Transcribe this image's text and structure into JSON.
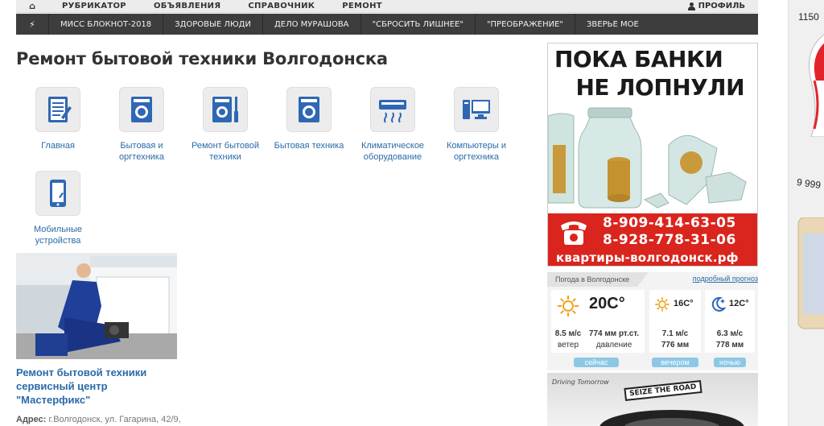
{
  "nav_top": {
    "home_icon": "home-icon",
    "items": [
      "РУБРИКАТОР",
      "ОБЪЯВЛЕНИЯ",
      "СПРАВОЧНИК",
      "РЕМОНТ"
    ],
    "profile": "ПРОФИЛЬ"
  },
  "nav_sub": {
    "bolt_icon": "bolt-icon",
    "items": [
      "МИСС БЛОКНОТ-2018",
      "ЗДОРОВЫЕ ЛЮДИ",
      "ДЕЛО МУРАШОВА",
      "\"СБРОСИТЬ ЛИШНЕЕ\"",
      "\"ПРЕОБРАЖЕНИЕ\"",
      "ЗВЕРЬЕ МОЕ"
    ]
  },
  "page_title": "Ремонт бытовой техники Волгодонска",
  "categories": [
    {
      "label": "Главная",
      "icon": "checklist-icon"
    },
    {
      "label": "Бытовая и оргтехника",
      "icon": "washing-machine-icon"
    },
    {
      "label": "Ремонт бытовой техники",
      "icon": "washing-machine-screwdriver-icon"
    },
    {
      "label": "Бытовая техника",
      "icon": "washing-machine-icon"
    },
    {
      "label": "Климатическое оборудование",
      "icon": "air-conditioner-icon"
    },
    {
      "label": "Компьютеры и оргтехника",
      "icon": "computer-icon"
    },
    {
      "label": "Мобильные устройства",
      "icon": "smartphone-icon"
    }
  ],
  "article": {
    "title": "Ремонт бытовой техники сервисный центр \"Мастерфикс\"",
    "address_label": "Адрес:",
    "address": "г.Волгодонск, ул. Гагарина, 42/9,"
  },
  "ad_banner": {
    "line1": "ПОКА БАНКИ",
    "line2": "НЕ ЛОПНУЛИ",
    "phone1": "8-909-414-63-05",
    "phone2": "8-928-778-31-06",
    "site": "квартиры-волгодонск.рф"
  },
  "weather": {
    "title": "Погода в Волгодонске",
    "more_link": "подробный прогноз",
    "now": {
      "temp": "20C°",
      "wind": "8.5 м/с",
      "wind_label": "ветер",
      "pressure": "774 мм рт.ст.",
      "pressure_label": "давление",
      "chip": "сейчас"
    },
    "evening": {
      "temp": "16C°",
      "wind": "7.1 м/с",
      "pressure": "776 мм",
      "chip": "вечером"
    },
    "night": {
      "temp": "12C°",
      "wind": "6.3 м/с",
      "pressure": "778 мм",
      "chip": "ночью"
    }
  },
  "ad_bottom": {
    "tagline": "Driving Tomorrow",
    "stamp": "SEIZE THE ROAD"
  },
  "side_ad": {
    "price1": "1150",
    "price2": "9 999"
  },
  "colors": {
    "link": "#2a6aa8",
    "nav_dark": "#3d3d3d",
    "ad_red": "#d9251d",
    "chip": "#8cc8e6"
  }
}
